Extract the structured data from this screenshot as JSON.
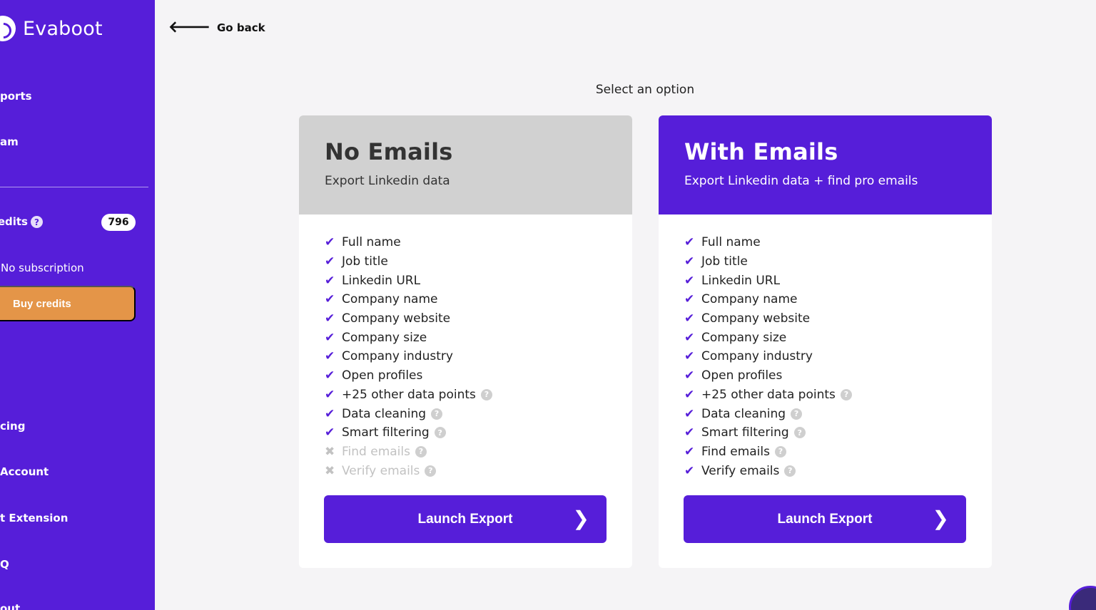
{
  "sidebar": {
    "logo_text": "Evaboot",
    "items": [
      {
        "label": "ports"
      },
      {
        "label": "am"
      },
      {
        "label": "cing"
      },
      {
        "label": "Account"
      },
      {
        "label": "t Extension"
      },
      {
        "label": "Q"
      },
      {
        "label": "out"
      }
    ],
    "credits_label": "credits",
    "credits_help": "?",
    "credits_count": "796",
    "subscription": "No subscription",
    "buy_label": "Buy credits"
  },
  "header": {
    "back_label": "Go back",
    "select_title": "Select an option"
  },
  "cards": [
    {
      "title": "No Emails",
      "subtitle": "Export Linkedin data",
      "features": [
        {
          "label": "Full name",
          "included": true,
          "help": false
        },
        {
          "label": "Job title",
          "included": true,
          "help": false
        },
        {
          "label": "Linkedin URL",
          "included": true,
          "help": false
        },
        {
          "label": "Company name",
          "included": true,
          "help": false
        },
        {
          "label": "Company website",
          "included": true,
          "help": false
        },
        {
          "label": "Company size",
          "included": true,
          "help": false
        },
        {
          "label": "Company industry",
          "included": true,
          "help": false
        },
        {
          "label": "Open profiles",
          "included": true,
          "help": false
        },
        {
          "label": "+25 other data points",
          "included": true,
          "help": true
        },
        {
          "label": "Data cleaning",
          "included": true,
          "help": true
        },
        {
          "label": "Smart filtering",
          "included": true,
          "help": true
        },
        {
          "label": "Find emails",
          "included": false,
          "help": true
        },
        {
          "label": "Verify emails",
          "included": false,
          "help": true
        }
      ],
      "button": "Launch Export"
    },
    {
      "title": "With Emails",
      "subtitle": "Export Linkedin data + find pro emails",
      "features": [
        {
          "label": "Full name",
          "included": true,
          "help": false
        },
        {
          "label": "Job title",
          "included": true,
          "help": false
        },
        {
          "label": "Linkedin URL",
          "included": true,
          "help": false
        },
        {
          "label": "Company name",
          "included": true,
          "help": false
        },
        {
          "label": "Company website",
          "included": true,
          "help": false
        },
        {
          "label": "Company size",
          "included": true,
          "help": false
        },
        {
          "label": "Company industry",
          "included": true,
          "help": false
        },
        {
          "label": "Open profiles",
          "included": true,
          "help": false
        },
        {
          "label": "+25 other data points",
          "included": true,
          "help": true
        },
        {
          "label": "Data cleaning",
          "included": true,
          "help": true
        },
        {
          "label": "Smart filtering",
          "included": true,
          "help": true
        },
        {
          "label": "Find emails",
          "included": true,
          "help": true
        },
        {
          "label": "Verify emails",
          "included": true,
          "help": true
        }
      ],
      "button": "Launch Export"
    }
  ],
  "icons": {
    "check": "check-icon",
    "cross": "cross-icon",
    "help": "question-circle-icon",
    "back": "arrow-left-icon",
    "chevron": "chevron-right-icon"
  },
  "colors": {
    "brand": "#561ed9",
    "buy": "#e49548",
    "card_neutral_head": "#d1d1d1",
    "disabled": "#c2c2c2"
  }
}
